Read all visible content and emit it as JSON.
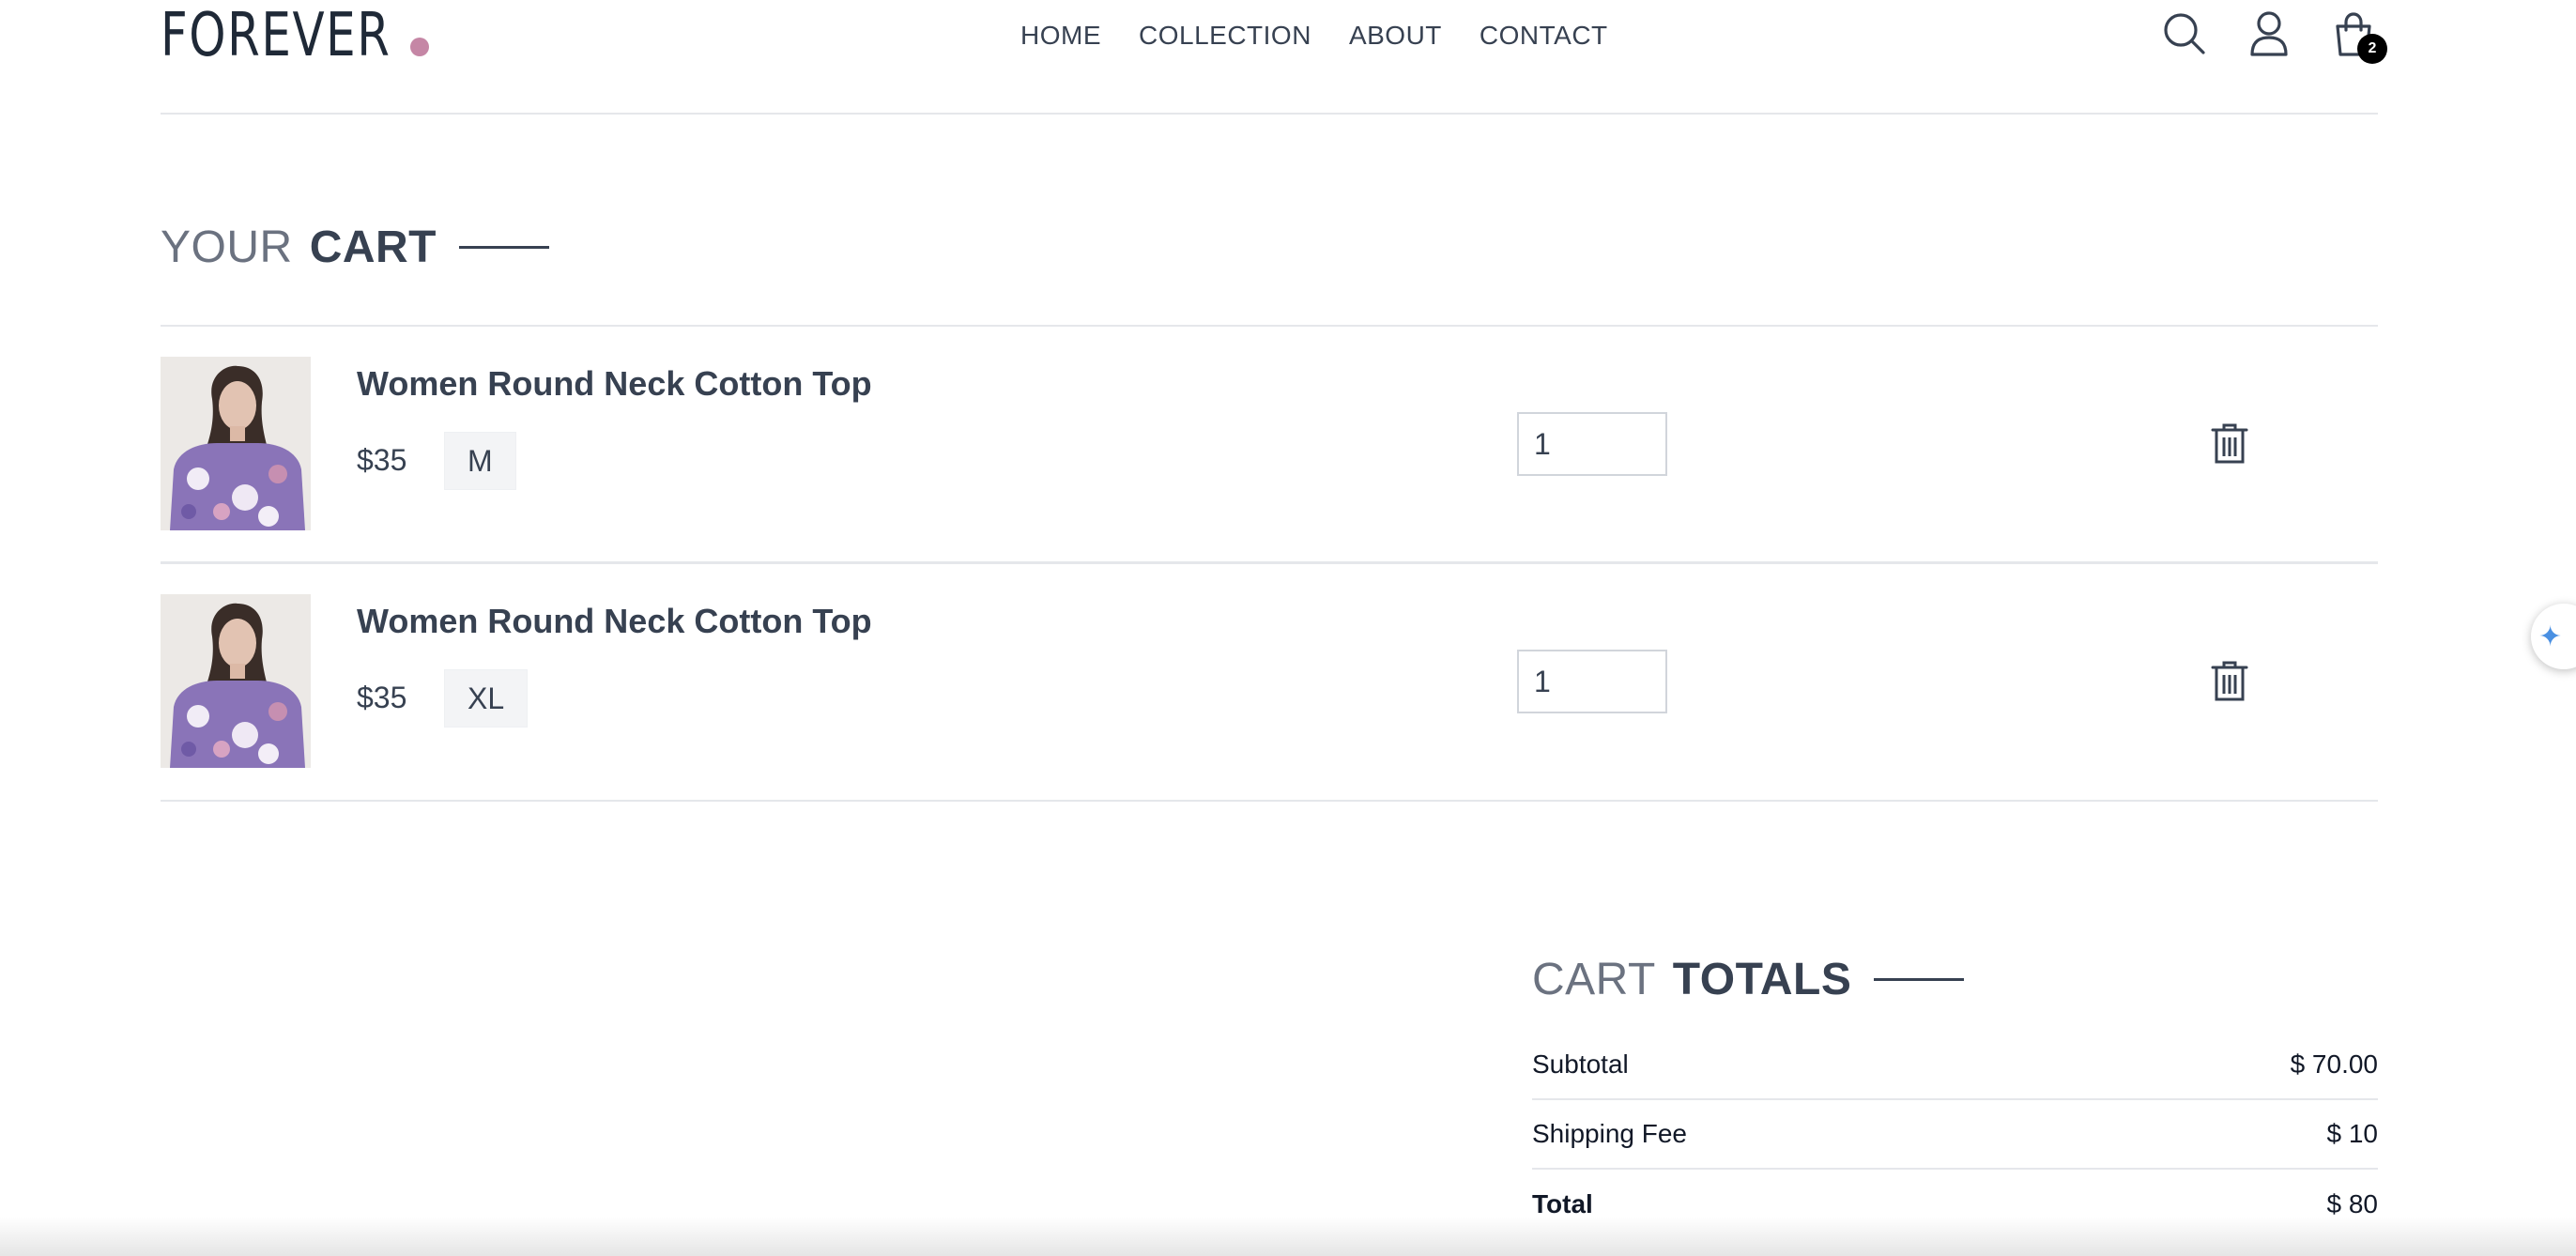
{
  "brand": {
    "name": "FOREVER",
    "dot_color": "#c586a5"
  },
  "nav": {
    "menu": [
      "HOME",
      "COLLECTION",
      "ABOUT",
      "CONTACT"
    ],
    "cart_count": "2"
  },
  "cart": {
    "title_light": "YOUR",
    "title_bold": "CART",
    "items": [
      {
        "name": "Women Round Neck Cotton Top",
        "price": "$35",
        "size": "M",
        "quantity": "1"
      },
      {
        "name": "Women Round Neck Cotton Top",
        "price": "$35",
        "size": "XL",
        "quantity": "1"
      }
    ]
  },
  "totals": {
    "title_light": "CART",
    "title_bold": "TOTALS",
    "rows": [
      {
        "label": "Subtotal",
        "value": "$ 70.00"
      },
      {
        "label": "Shipping Fee",
        "value": "$ 10"
      },
      {
        "label": "Total",
        "value": "$ 80"
      }
    ]
  },
  "colors": {
    "accent": "#374151",
    "muted": "#6b7280",
    "divider": "#e5e7eb",
    "badge_bg": "#f3f4f6"
  }
}
